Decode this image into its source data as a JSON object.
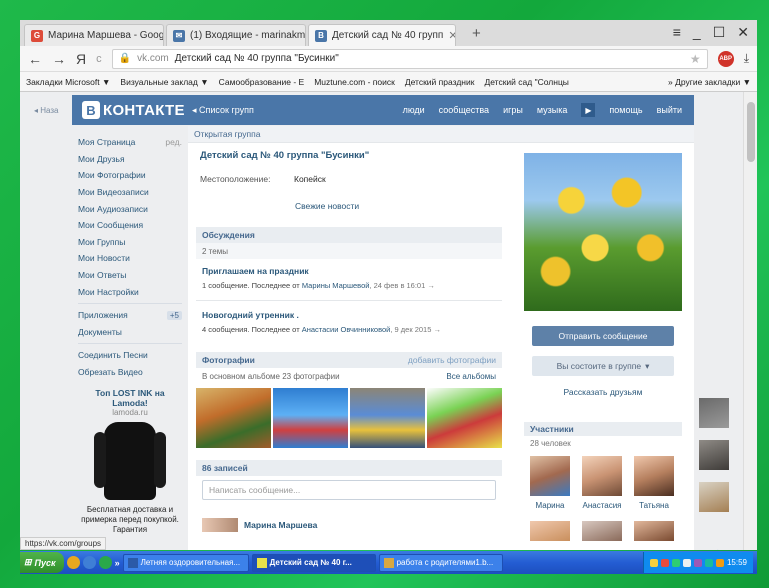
{
  "browser": {
    "tabs": [
      {
        "label": "Марина Маршева - Goog",
        "favicon": "G",
        "color": "#dd4b39"
      },
      {
        "label": "(1) Входящие - marinakm",
        "favicon": "✉",
        "color": "#4a76a8"
      },
      {
        "label": "Детский сад № 40 групп",
        "favicon": "В",
        "color": "#4a76a8",
        "active": true
      }
    ],
    "new_tab": "+",
    "window_controls": [
      "≡",
      "_",
      "☐",
      "✕"
    ],
    "nav": {
      "back": "←",
      "forward": "→",
      "ya": "Я",
      "reload": "c"
    },
    "url_domain": "vk.com",
    "url_title": "Детский сад № 40 группа \"Бусинки\"",
    "adblock_label": "ABP",
    "download_icon": "⤓",
    "bookmarks": [
      "Закладки Microsoft ▼",
      "Визуальные заклад ▼",
      "Самообразование - E",
      "Muztune.com - поиск",
      "Детский праздник",
      "Детский сад \"Солнцы"
    ],
    "other_bookmarks": "» Другие закладки ▼"
  },
  "vk": {
    "logo_letter": "В",
    "logo_text": "КОНТАКТЕ",
    "back_to_groups": "◂ Список групп",
    "back_left": "◂ Наза",
    "menu": [
      "люди",
      "сообщества",
      "игры",
      "музыка",
      "помощь",
      "выйти"
    ],
    "menu_arrow": "▶",
    "left_menu": [
      {
        "label": "Моя Страница",
        "extra": "ред."
      },
      {
        "label": "Мои Друзья"
      },
      {
        "label": "Мои Фотографии"
      },
      {
        "label": "Мои Видеозаписи"
      },
      {
        "label": "Мои Аудиозаписи"
      },
      {
        "label": "Мои Сообщения"
      },
      {
        "label": "Мои Группы"
      },
      {
        "label": "Мои Новости"
      },
      {
        "label": "Мои Ответы"
      },
      {
        "label": "Мои Настройки"
      }
    ],
    "left_menu2": [
      {
        "label": "Приложения",
        "badge": "+5"
      },
      {
        "label": "Документы"
      }
    ],
    "left_menu3": [
      {
        "label": "Соединить Песни"
      },
      {
        "label": "Обрезать Видео"
      }
    ],
    "ad": {
      "title": "Топ LOST INK на Lamoda!",
      "domain": "lamoda.ru",
      "text": "Бесплатная доставка и примерка перед покупкой. Гарантия"
    },
    "group": {
      "type": "Открытая группа",
      "title": "Детский сад № 40 группа \"Бусинки\"",
      "location_label": "Местоположение:",
      "location_value": "Копейск",
      "fresh_news": "Свежие новости"
    },
    "discussions": {
      "title": "Обсуждения",
      "count": "2 темы",
      "topics": [
        {
          "title": "Приглашаем на праздник",
          "meta": "1 сообщение. Последнее от",
          "who": "Марины Маршевой",
          "date": ", 24 фев в 16:01 →"
        },
        {
          "title": "Новогодний утренник .",
          "meta": "4 сообщения. Последнее от",
          "who": "Анастасии Овчинниковой",
          "date": ", 9 дек 2015 →"
        }
      ]
    },
    "photos": {
      "title": "Фотографии",
      "add": "добавить фотографии",
      "sub": "В основном альбоме 23 фотографии",
      "all": "Все альбомы"
    },
    "wall": {
      "title": "86 записей",
      "placeholder": "Написать сообщение...",
      "author": "Марина Маршева"
    },
    "side": {
      "send_message": "Отправить сообщение",
      "membership": "Вы состоите в группе",
      "membership_caret": "▾",
      "tell_friends": "Рассказать друзьям",
      "members_title": "Участники",
      "members_count": "28 человек",
      "members": [
        "Марина",
        "Анастасия",
        "Татьяна"
      ]
    },
    "people_count": "3 👤"
  },
  "status_url": "https://vk.com/groups",
  "taskbar": {
    "start": "Пуск",
    "quick_more": "»",
    "tasks": [
      {
        "label": "Летняя оздоровительная...",
        "active": false
      },
      {
        "label": "Детский сад № 40 г...",
        "active": true
      },
      {
        "label": "работа с родителями1.b...",
        "active": false
      }
    ],
    "time": "15:59"
  }
}
